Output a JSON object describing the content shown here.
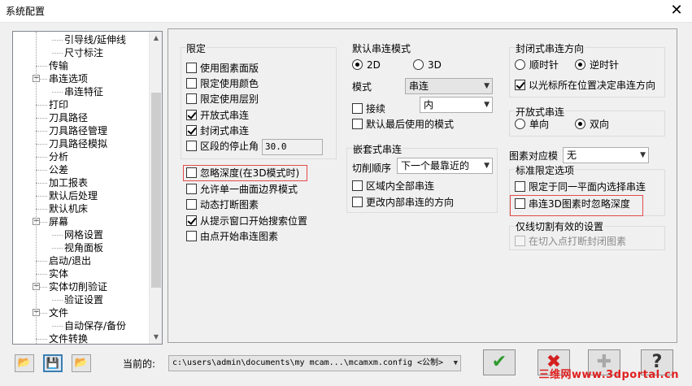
{
  "window": {
    "title": "系统配置",
    "close_glyph": "✕"
  },
  "tree": {
    "items": [
      {
        "label": "引导线/延伸线",
        "level": 2
      },
      {
        "label": "尺寸标注",
        "level": 2
      },
      {
        "label": "传输",
        "level": 1
      },
      {
        "label": "串连选项",
        "level": 1,
        "expander": "−"
      },
      {
        "label": "串连特征",
        "level": 2
      },
      {
        "label": "打印",
        "level": 1
      },
      {
        "label": "刀具路径",
        "level": 1
      },
      {
        "label": "刀具路径管理",
        "level": 1
      },
      {
        "label": "刀具路径模拟",
        "level": 1
      },
      {
        "label": "分析",
        "level": 1
      },
      {
        "label": "公差",
        "level": 1
      },
      {
        "label": "加工报表",
        "level": 1
      },
      {
        "label": "默认后处理",
        "level": 1
      },
      {
        "label": "默认机床",
        "level": 1
      },
      {
        "label": "屏幕",
        "level": 1,
        "expander": "−"
      },
      {
        "label": "网格设置",
        "level": 2
      },
      {
        "label": "视角面板",
        "level": 2
      },
      {
        "label": "启动/退出",
        "level": 1
      },
      {
        "label": "实体",
        "level": 1
      },
      {
        "label": "实体切削验证",
        "level": 1,
        "expander": "−"
      },
      {
        "label": "验证设置",
        "level": 2
      },
      {
        "label": "文件",
        "level": 1,
        "expander": "−"
      },
      {
        "label": "自动保存/备份",
        "level": 2
      },
      {
        "label": "文件转换",
        "level": 1
      }
    ],
    "scroll_up": "▲",
    "scroll_down": "▼"
  },
  "limit": {
    "title": "限定",
    "options": [
      {
        "label": "使用图素面版",
        "checked": false
      },
      {
        "label": "限定使用颜色",
        "checked": false
      },
      {
        "label": "限定使用层别",
        "checked": false
      },
      {
        "label": "开放式串连",
        "checked": true
      },
      {
        "label": "封闭式串连",
        "checked": true
      },
      {
        "label": "区段的停止角",
        "checked": false
      }
    ],
    "stop_angle_value": "30.0"
  },
  "misc_options": [
    {
      "label": "忽略深度(在3D模式时)",
      "checked": false
    },
    {
      "label": "允许单一曲面边界模式",
      "checked": false
    },
    {
      "label": "动态打断图素",
      "checked": false
    },
    {
      "label": "从提示窗口开始搜索位置",
      "checked": true
    },
    {
      "label": "由点开始串连图素",
      "checked": false
    }
  ],
  "default_chain_mode": {
    "title": "默认串连模式",
    "radio_2d": "2D",
    "radio_3d": "3D",
    "selected": "2D",
    "mode_label": "模式",
    "mode_value": "串连",
    "follow_label": "接续",
    "follow_checked": false,
    "follow_value": "内",
    "last_used_label": "默认最后使用的模式",
    "last_used_checked": false
  },
  "nested_chain": {
    "title": "嵌套式串连",
    "cut_order_label": "切削顺序",
    "cut_order_value": "下一个最靠近的",
    "options": [
      {
        "label": "区域内全部串连",
        "checked": false
      },
      {
        "label": "更改内部串连的方向",
        "checked": false
      }
    ]
  },
  "closed_direction": {
    "title": "封闭式串连方向",
    "cw": "顺时针",
    "ccw": "逆时针",
    "selected": "逆时针",
    "cursor_option": {
      "label": "以光标所在位置决定串连方向",
      "checked": true
    }
  },
  "open_chain": {
    "title": "开放式串连",
    "single": "单向",
    "double": "双向",
    "selected": "双向"
  },
  "entity_match": {
    "label": "图素对应模",
    "value": "无"
  },
  "standard_limit": {
    "title": "标准限定选项",
    "options": [
      {
        "label": "限定于同一平面内选择串连",
        "checked": false
      },
      {
        "label": "串连3D图素时忽略深度",
        "checked": false
      }
    ]
  },
  "wireframe_cut": {
    "title": "仅线切割有效的设置",
    "option": {
      "label": "在切入点打断封闭图素",
      "checked": false
    }
  },
  "bottom": {
    "current_label": "当前的:",
    "current_value": "c:\\users\\admin\\documents\\my mcam...\\mcamxm.config <公制>",
    "ok_glyph": "✔",
    "cancel_glyph": "✖",
    "add_glyph": "✚",
    "help_glyph": "?",
    "tool_open_glyph": "📂",
    "tool_save_glyph": "💾",
    "tool_merge_glyph": "📂"
  },
  "watermark": "三维网www.3dportal.cn",
  "colors": {
    "highlight_red": "#e24b4b",
    "ok_green": "#2e9a2e",
    "cancel_red": "#d42020"
  }
}
